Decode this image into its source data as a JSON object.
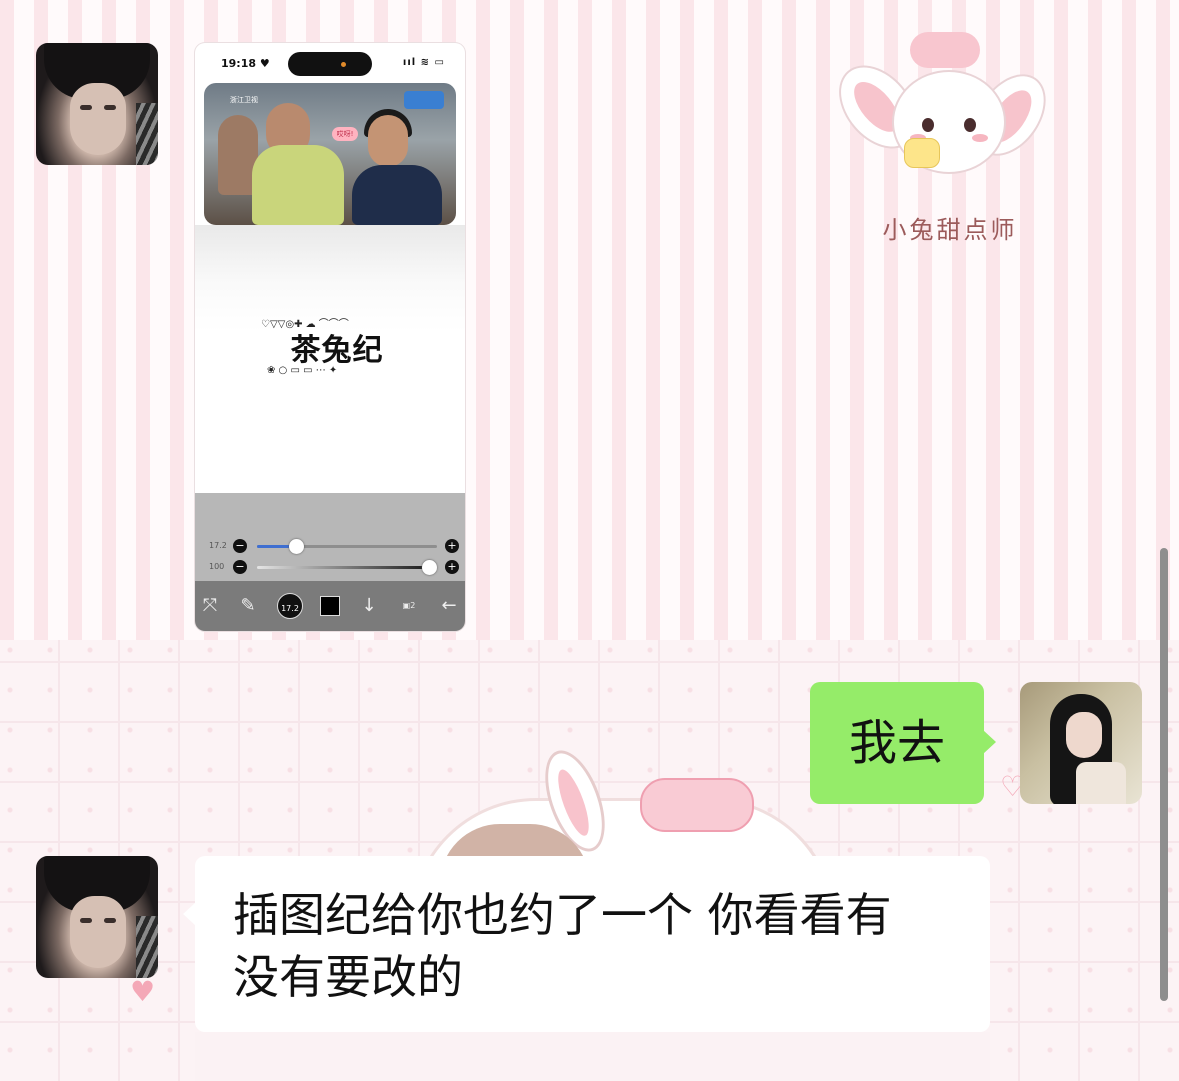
{
  "phone_screenshot": {
    "status_time": "19:18 ♥",
    "status_icons": "ııl ≋ ▭",
    "tv_badge": "哎呀!",
    "tv_logo": "浙江卫视",
    "canvas_title": "茶兔纪",
    "brush_size_value": "17.2",
    "opacity_value": "100",
    "brush_size_fraction": 0.22,
    "opacity_fraction": 1.0,
    "toolbar_brush_size": "17.2",
    "layers_count": "2",
    "icons": [
      "transform-icon",
      "brush-icon",
      "brush-size-icon",
      "color-swatch-icon",
      "download-icon",
      "layers-icon",
      "back-arrow-icon"
    ]
  },
  "sticker": {
    "caption": "小兔甜点师"
  },
  "messages": [
    {
      "side": "left",
      "type": "image",
      "avatar": "avatar-friend"
    },
    {
      "side": "right",
      "type": "text",
      "text": "我去",
      "avatar": "avatar-me",
      "bubble_color": "#95ec69"
    },
    {
      "side": "left",
      "type": "text",
      "text_line1": "插图纪给你也约了一个 你看看有",
      "text_line2": "没有要改的",
      "avatar": "avatar-friend",
      "bubble_color": "#ffffff"
    }
  ]
}
